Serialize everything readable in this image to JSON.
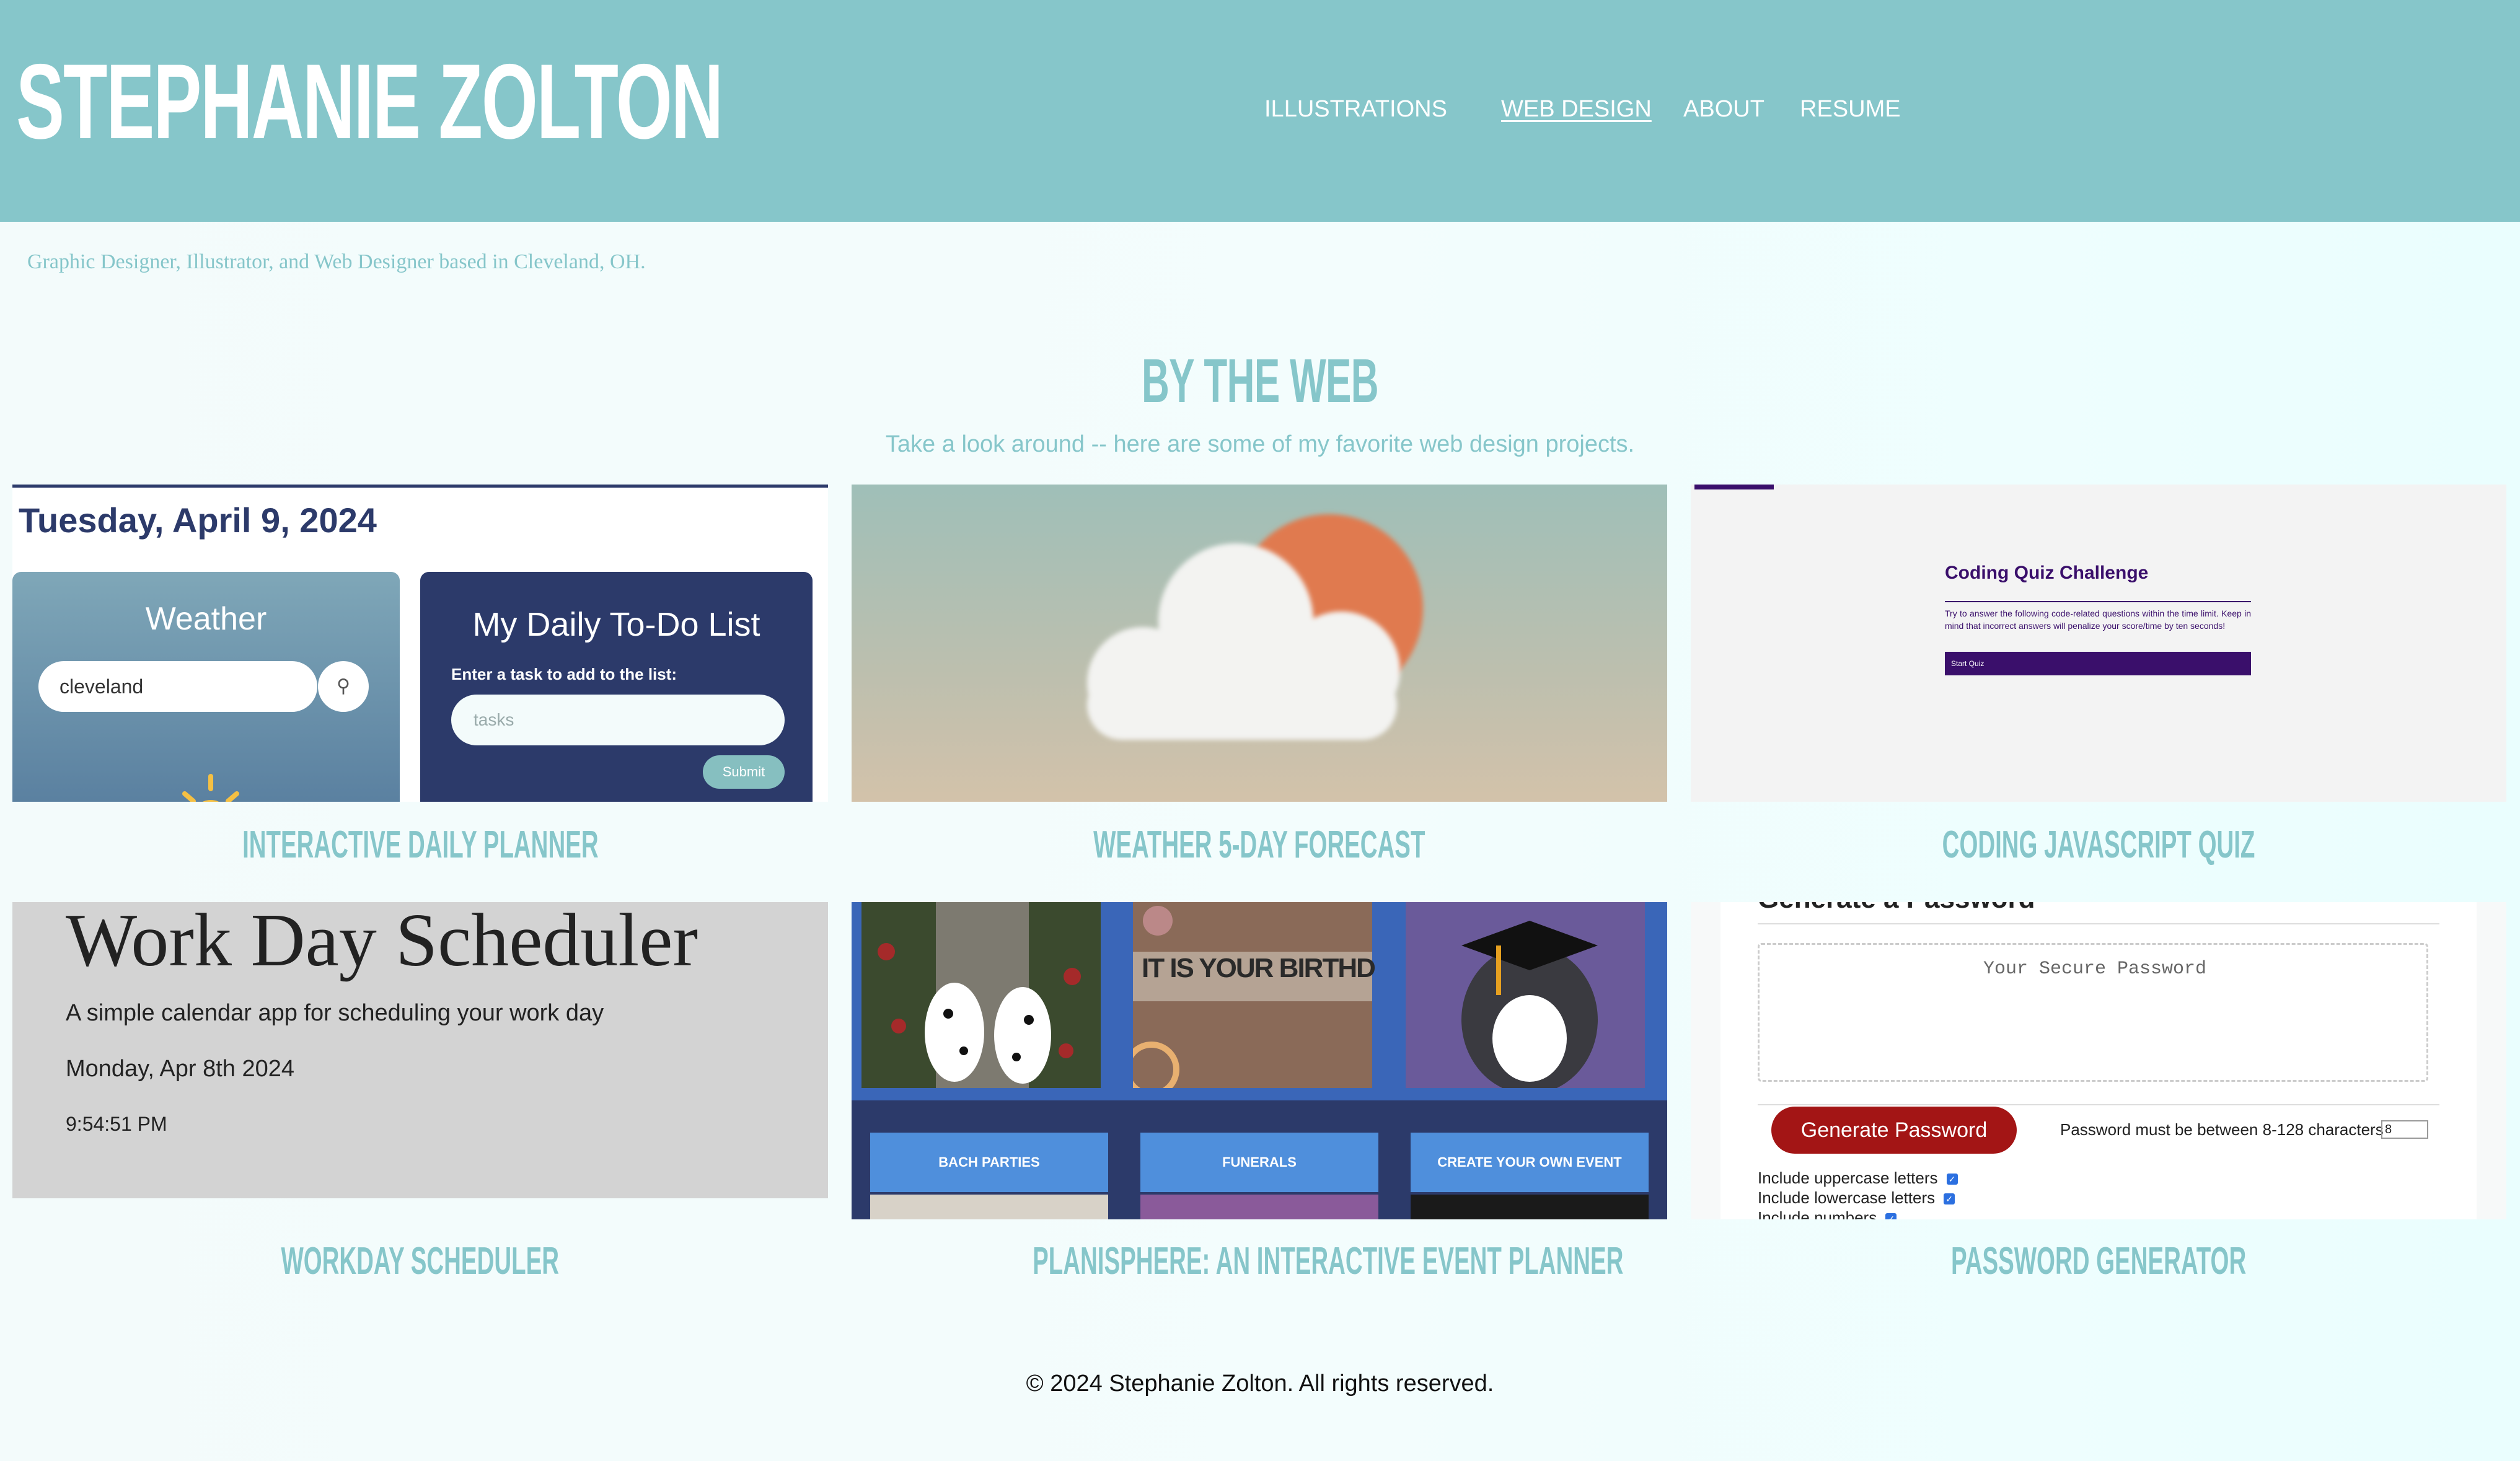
{
  "header": {
    "site_title": "STEPHANIE ZOLTON",
    "nav": [
      "ILLUSTRATIONS",
      "WEB DESIGN",
      "ABOUT",
      "RESUME"
    ],
    "active_nav": "WEB DESIGN",
    "tagline": "Graphic Designer, Illustrator, and Web Designer based in Cleveland, OH.",
    "background_color": "#86c6ca"
  },
  "section": {
    "title": "BY THE WEB",
    "subtitle": "Take a look around -- here are some of my favorite web design projects."
  },
  "projects": [
    {
      "title": "INTERACTIVE DAILY PLANNER",
      "preview": {
        "date": "Tuesday, April 9, 2024",
        "weather_heading": "Weather",
        "weather_input_value": "cleveland",
        "todo_heading": "My Daily To-Do List",
        "todo_label": "Enter a task to add to the list:",
        "todo_placeholder": "tasks",
        "todo_submit": "Submit"
      }
    },
    {
      "title": "WEATHER 5-DAY FORECAST",
      "preview": {
        "icon": "cloud-sun-icon"
      }
    },
    {
      "title": "CODING JAVASCRIPT QUIZ",
      "preview": {
        "heading": "Coding Quiz Challenge",
        "text": "Try to answer the following code-related questions within the time limit. Keep in mind that incorrect answers will penalize your score/time by ten seconds!",
        "button": "Start Quiz"
      }
    },
    {
      "title": "WORKDAY SCHEDULER",
      "preview": {
        "heading": "Work Day Scheduler",
        "subheading": "A simple calendar app for scheduling your work day",
        "date": "Monday, Apr 8th 2024",
        "time": "9:54:51 PM"
      }
    },
    {
      "title": "PLANISPHERE: AN INTERACTIVE EVENT PLANNER",
      "preview": {
        "banner_text": "IT IS YOUR BIRTHD",
        "buttons": [
          "BACH PARTIES",
          "FUNERALS",
          "CREATE YOUR OWN EVENT"
        ]
      }
    },
    {
      "title": "PASSWORD GENERATOR",
      "preview": {
        "heading": "Generate a Password",
        "placeholder": "Your Secure Password",
        "button": "Generate Password",
        "length_label": "Password must be between 8-128 characters",
        "length_value": "8",
        "options": [
          "Include uppercase letters",
          "Include lowercase letters",
          "Include numbers"
        ]
      }
    }
  ],
  "footer": {
    "copyright": "© 2024 Stephanie Zolton. All rights reserved."
  }
}
